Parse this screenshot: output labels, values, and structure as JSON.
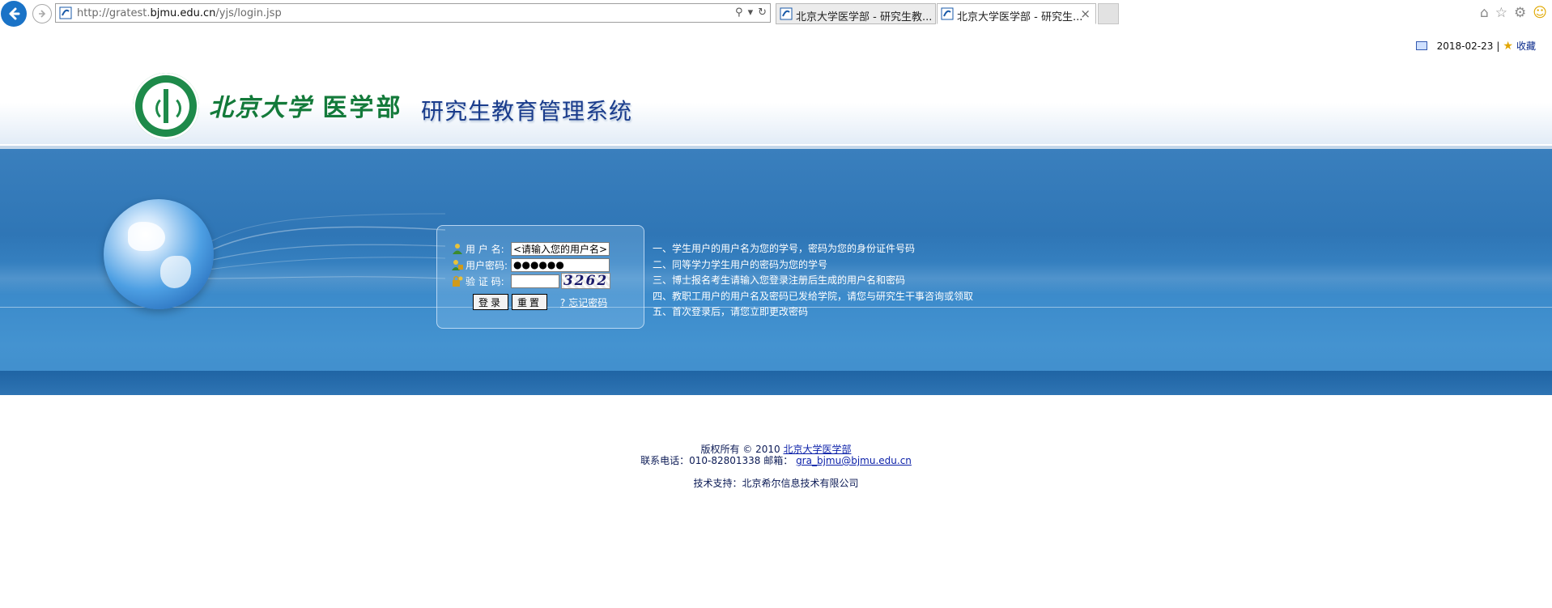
{
  "browser": {
    "url_prefix": "http://gratest.",
    "url_domain": "bjmu.edu.cn",
    "url_path": "/yjs/login.jsp",
    "tabs": [
      {
        "label": "北京大学医学部 - 研究生教..."
      },
      {
        "label": "北京大学医学部 - 研究生..."
      }
    ],
    "close_glyph": "×"
  },
  "topbar": {
    "date": "2018-02-23",
    "separator": "|",
    "favorite_label": "收藏"
  },
  "header": {
    "university": "北京大学",
    "school": "医学部",
    "system_title": "研究生教育管理系统"
  },
  "login": {
    "username_label": "用 户 名:",
    "username_value": "<请输入您的用户名>",
    "password_label": "用户密码:",
    "password_value": "●●●●●●",
    "captcha_label": "验 证 码:",
    "captcha_value": "",
    "captcha_text": "3262",
    "login_button": "登录",
    "reset_button": "重置",
    "forgot_link": "忘记密码"
  },
  "notes": [
    "一、学生用户的用户名为您的学号，密码为您的身份证件号码",
    "二、同等学力学生用户的密码为您的学号",
    "三、博士报名考生请输入您登录注册后生成的用户名和密码",
    "四、教职工用户的用户名及密码已发给学院，请您与研究生干事咨询或领取",
    "五、首次登录后，请您立即更改密码"
  ],
  "footer": {
    "copyright": "版权所有 © 2010",
    "copyright_link": "北京大学医学部",
    "contact": "联系电话：010-82801338 邮箱：",
    "email": "gra_bjmu@bjmu.edu.cn",
    "support": "技术支持：北京希尔信息技术有限公司"
  },
  "colors": {
    "band_blue": "#2f76b6",
    "title_blue": "#1a3c8c",
    "logo_green": "#137a3a"
  }
}
